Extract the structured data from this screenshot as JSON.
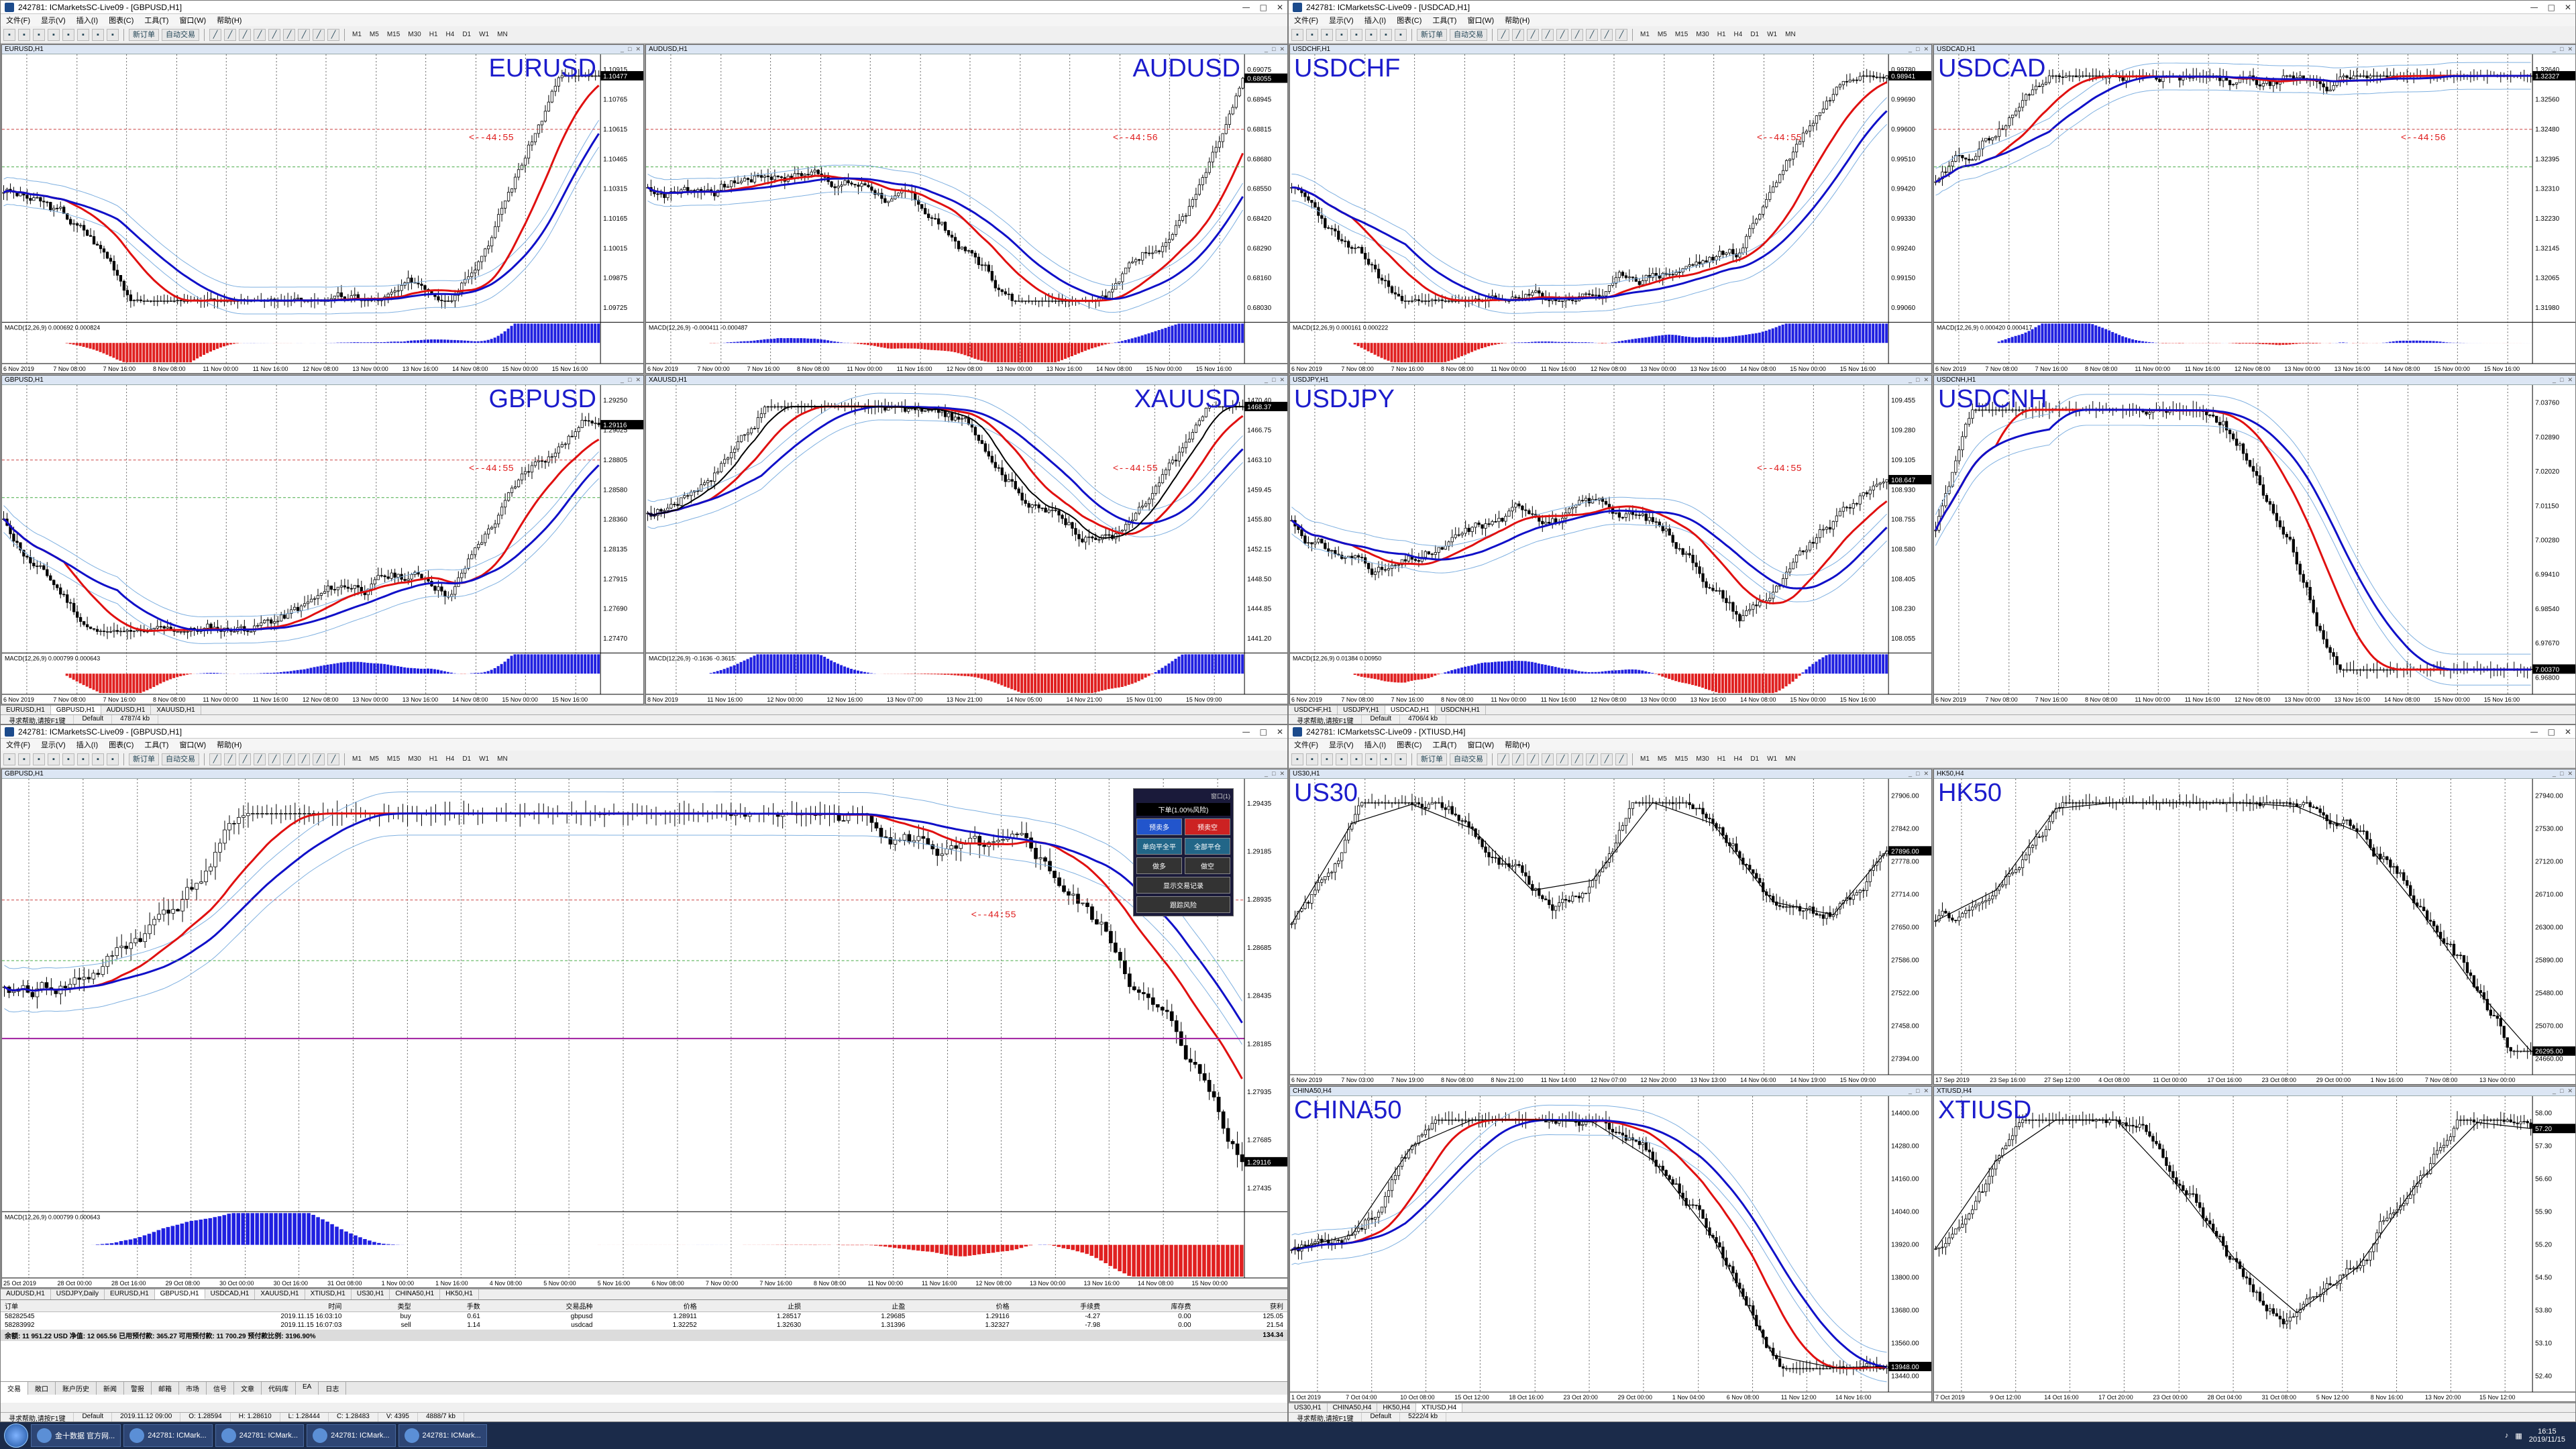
{
  "windows": [
    {
      "id": "tl",
      "title": "242781: ICMarketsSC-Live09 - [GBPUSD,H1]",
      "tabs": [
        "EURUSD,H1",
        "GBPUSD,H1",
        "AUDUSD,H1",
        "XAUUSD,H1"
      ],
      "active_tab": 1,
      "status": {
        "left": "寻求帮助,请按F1键",
        "mid": "Default",
        "right": "4787/4 kb"
      }
    },
    {
      "id": "tr",
      "title": "242781: ICMarketsSC-Live09 - [USDCAD,H1]",
      "tabs": [
        "USDCHF,H1",
        "USDJPY,H1",
        "USDCAD,H1",
        "USDCNH,H1"
      ],
      "active_tab": 2,
      "status": {
        "left": "寻求帮助,请按F1键",
        "mid": "Default",
        "right": "4706/4 kb"
      }
    },
    {
      "id": "bl",
      "title": "242781: ICMarketsSC-Live09 - [GBPUSD,H1]",
      "tabs": [
        "AUDUSD,H1",
        "USDJPY,Daily",
        "EURUSD,H1",
        "GBPUSD,H1",
        "USDCAD,H1",
        "XAUUSD,H1",
        "XTIUSD,H1",
        "US30,H1",
        "CHINA50,H1",
        "HK50,H1"
      ],
      "active_tab": 3,
      "status": {
        "left": "寻求帮助,请按F1键",
        "mid": "Default",
        "date": "2019.11.12 09:00",
        "o": "O: 1.28594",
        "h": "H: 1.28610",
        "l": "L: 1.28444",
        "c": "C: 1.28483",
        "v": "V: 4395",
        "right": "4888/7 kb"
      }
    },
    {
      "id": "br",
      "title": "242781: ICMarketsSC-Live09 - [XTIUSD,H4]",
      "tabs": [
        "US30,H1",
        "CHINA50,H4",
        "HK50,H4",
        "XTIUSD,H4"
      ],
      "active_tab": 3,
      "status": {
        "left": "寻求帮助,请按F1键",
        "mid": "Default",
        "right": "5222/4 kb"
      }
    }
  ],
  "menu": [
    "文件(F)",
    "显示(V)",
    "插入(I)",
    "图表(C)",
    "工具(T)",
    "窗口(W)",
    "帮助(H)"
  ],
  "toolbar": {
    "new_order": "新订单",
    "autotrade": "自动交易",
    "timeframes": [
      "M1",
      "M5",
      "M15",
      "M30",
      "H1",
      "H4",
      "D1",
      "W1",
      "MN"
    ]
  },
  "charts": [
    {
      "win": "tl",
      "head": "EURUSD,H1",
      "label": "EURUSD",
      "countdown": "<--44:55",
      "macd": "MACD(12,26,9) 0.000692 0.000824",
      "xaxis": [
        "6 Nov 2019",
        "7 Nov 08:00",
        "7 Nov 16:00",
        "8 Nov 08:00",
        "11 Nov 00:00",
        "11 Nov 16:00",
        "12 Nov 08:00",
        "13 Nov 00:00",
        "13 Nov 16:00",
        "14 Nov 08:00",
        "15 Nov 00:00",
        "15 Nov 16:00"
      ],
      "yaxis": [
        "1.10915",
        "1.10765",
        "1.10615",
        "1.10465",
        "1.10315",
        "1.10165",
        "1.10015",
        "1.09875",
        "1.09725"
      ],
      "price": "1.10477",
      "ml": true,
      "style": "fx",
      "seed": 3
    },
    {
      "win": "tl",
      "head": "AUDUSD,H1",
      "label": "AUDUSD",
      "countdown": "<--44:56",
      "macd": "MACD(12,26,9) -0.000411 -0.000487",
      "xaxis": [
        "6 Nov 2019",
        "7 Nov 00:00",
        "7 Nov 16:00",
        "8 Nov 08:00",
        "11 Nov 00:00",
        "11 Nov 16:00",
        "12 Nov 08:00",
        "13 Nov 00:00",
        "13 Nov 16:00",
        "14 Nov 08:00",
        "15 Nov 00:00",
        "15 Nov 16:00"
      ],
      "yaxis": [
        "0.69075",
        "0.68945",
        "0.68815",
        "0.68680",
        "0.68550",
        "0.68420",
        "0.68290",
        "0.68160",
        "0.68030"
      ],
      "price": "0.68055",
      "ml": true,
      "style": "fx",
      "seed": 7
    },
    {
      "win": "tl",
      "head": "GBPUSD,H1",
      "label": "GBPUSD",
      "countdown": "<--44:55",
      "macd": "MACD(12,26,9) 0.000799 0.000643",
      "xaxis": [
        "6 Nov 2019",
        "7 Nov 08:00",
        "7 Nov 16:00",
        "8 Nov 08:00",
        "11 Nov 00:00",
        "11 Nov 16:00",
        "12 Nov 08:00",
        "13 Nov 00:00",
        "13 Nov 16:00",
        "14 Nov 08:00",
        "15 Nov 00:00",
        "15 Nov 16:00"
      ],
      "yaxis": [
        "1.29250",
        "1.29025",
        "1.28805",
        "1.28580",
        "1.28360",
        "1.28135",
        "1.27915",
        "1.27690",
        "1.27470"
      ],
      "price": "1.29116",
      "ml": true,
      "style": "fx",
      "seed": 11
    },
    {
      "win": "tl",
      "head": "XAUUSD,H1",
      "label": "XAUUSD",
      "countdown": "<--44:55",
      "macd": "MACD(12,26,9) -0.1636 -0.3615",
      "xaxis": [
        "8 Nov 2019",
        "11 Nov 16:00",
        "12 Nov 00:00",
        "12 Nov 16:00",
        "13 Nov 07:00",
        "13 Nov 21:00",
        "14 Nov 05:00",
        "14 Nov 21:00",
        "15 Nov 01:00",
        "15 Nov 09:00"
      ],
      "yaxis": [
        "1470.40",
        "1466.75",
        "1463.10",
        "1459.45",
        "1455.80",
        "1452.15",
        "1448.50",
        "1444.85",
        "1441.20"
      ],
      "price": "1468.37",
      "ml": false,
      "style": "gold",
      "seed": 17
    },
    {
      "win": "tr",
      "head": "USDCHF,H1",
      "label": "USDCHF",
      "countdown": "<--44:55",
      "macd": "MACD(12,26,9) 0.000161 0.000222",
      "xaxis": [
        "6 Nov 2019",
        "7 Nov 08:00",
        "7 Nov 16:00",
        "8 Nov 08:00",
        "11 Nov 00:00",
        "11 Nov 16:00",
        "12 Nov 08:00",
        "13 Nov 00:00",
        "13 Nov 16:00",
        "14 Nov 08:00",
        "15 Nov 00:00",
        "15 Nov 16:00"
      ],
      "yaxis": [
        "0.99780",
        "0.99690",
        "0.99600",
        "0.99510",
        "0.99420",
        "0.99330",
        "0.99240",
        "0.99150",
        "0.99060"
      ],
      "price": "0.98941",
      "ml": false,
      "style": "fx",
      "seed": 23
    },
    {
      "win": "tr",
      "head": "USDCAD,H1",
      "label": "USDCAD",
      "countdown": "<--44:56",
      "macd": "MACD(12,26,9) 0.000420 0.000417",
      "xaxis": [
        "6 Nov 2019",
        "7 Nov 08:00",
        "7 Nov 16:00",
        "8 Nov 08:00",
        "11 Nov 00:00",
        "11 Nov 16:00",
        "12 Nov 08:00",
        "13 Nov 00:00",
        "13 Nov 16:00",
        "14 Nov 08:00",
        "15 Nov 00:00",
        "15 Nov 16:00"
      ],
      "yaxis": [
        "1.32640",
        "1.32560",
        "1.32480",
        "1.32395",
        "1.32310",
        "1.32230",
        "1.32145",
        "1.32065",
        "1.31980"
      ],
      "price": "1.32327",
      "ml": true,
      "style": "fxup",
      "seed": 29
    },
    {
      "win": "tr",
      "head": "USDJPY,H1",
      "label": "USDJPY",
      "countdown": "<--44:55",
      "macd": "MACD(12,26,9) 0.01384 0.00950",
      "xaxis": [
        "6 Nov 2019",
        "7 Nov 08:00",
        "7 Nov 16:00",
        "8 Nov 08:00",
        "11 Nov 00:00",
        "11 Nov 16:00",
        "12 Nov 08:00",
        "13 Nov 00:00",
        "13 Nov 16:00",
        "14 Nov 08:00",
        "15 Nov 00:00",
        "15 Nov 16:00"
      ],
      "yaxis": [
        "109.455",
        "109.280",
        "109.105",
        "108.930",
        "108.755",
        "108.580",
        "108.405",
        "108.230",
        "108.055"
      ],
      "price": "108.647",
      "ml": false,
      "style": "fx",
      "seed": 31
    },
    {
      "win": "tr",
      "head": "USDCNH,H1",
      "label": "USDCNH",
      "countdown": "",
      "macd": "",
      "xaxis": [
        "6 Nov 2019",
        "7 Nov 08:00",
        "7 Nov 16:00",
        "8 Nov 08:00",
        "11 Nov 00:00",
        "11 Nov 16:00",
        "12 Nov 08:00",
        "13 Nov 00:00",
        "13 Nov 16:00",
        "14 Nov 08:00",
        "15 Nov 00:00",
        "15 Nov 16:00"
      ],
      "yaxis": [
        "7.03760",
        "7.02890",
        "7.02020",
        "7.01150",
        "7.00280",
        "6.99410",
        "6.98540",
        "6.97670",
        "6.96800"
      ],
      "price": "7.00370",
      "ml": false,
      "style": "cnh",
      "seed": 37
    },
    {
      "win": "bl",
      "head": "GBPUSD,H1",
      "label": "",
      "countdown": "<--44:55",
      "macd": "MACD(12,26,9) 0.000799 0.000643",
      "xaxis": [
        "25 Oct 2019",
        "28 Oct 00:00",
        "28 Oct 16:00",
        "29 Oct 08:00",
        "30 Oct 00:00",
        "30 Oct 16:00",
        "31 Oct 08:00",
        "1 Nov 00:00",
        "1 Nov 16:00",
        "4 Nov 08:00",
        "5 Nov 00:00",
        "5 Nov 16:00",
        "6 Nov 08:00",
        "7 Nov 00:00",
        "7 Nov 16:00",
        "8 Nov 08:00",
        "11 Nov 00:00",
        "11 Nov 16:00",
        "12 Nov 08:00",
        "13 Nov 00:00",
        "13 Nov 16:00",
        "14 Nov 08:00",
        "15 Nov 00:00"
      ],
      "yaxis": [
        "1.29435",
        "1.29185",
        "1.28935",
        "1.28685",
        "1.28435",
        "1.28185",
        "1.27935",
        "1.27685",
        "1.27435"
      ],
      "price": "1.29116",
      "ml": true,
      "style": "big",
      "seed": 41
    },
    {
      "win": "br",
      "head": "US30,H1",
      "label": "US30",
      "countdown": "",
      "macd": "",
      "xaxis": [
        "6 Nov 2019",
        "7 Nov 03:00",
        "7 Nov 19:00",
        "8 Nov 08:00",
        "8 Nov 21:00",
        "11 Nov 14:00",
        "12 Nov 07:00",
        "12 Nov 20:00",
        "13 Nov 13:00",
        "14 Nov 06:00",
        "14 Nov 19:00",
        "15 Nov 09:00"
      ],
      "yaxis": [
        "27906.00",
        "27842.00",
        "27778.00",
        "27714.00",
        "27650.00",
        "27586.00",
        "27522.00",
        "27458.00",
        "27394.00"
      ],
      "price": "27896.00",
      "ml": false,
      "style": "zig",
      "seed": 43
    },
    {
      "win": "br",
      "head": "HK50,H4",
      "label": "HK50",
      "countdown": "",
      "macd": "",
      "xaxis": [
        "17 Sep 2019",
        "23 Sep 16:00",
        "27 Sep 12:00",
        "4 Oct 08:00",
        "11 Oct 00:00",
        "17 Oct 16:00",
        "23 Oct 08:00",
        "29 Oct 00:00",
        "1 Nov 16:00",
        "7 Nov 08:00",
        "13 Nov 00:00"
      ],
      "yaxis": [
        "27940.00",
        "27530.00",
        "27120.00",
        "26710.00",
        "26300.00",
        "25890.00",
        "25480.00",
        "25070.00",
        "24660.00"
      ],
      "price": "26295.00",
      "ml": false,
      "style": "hk",
      "seed": 47
    },
    {
      "win": "br",
      "head": "CHINA50,H4",
      "label": "CHINA50",
      "countdown": "",
      "macd": "",
      "xaxis": [
        "1 Oct 2019",
        "7 Oct 04:00",
        "10 Oct 08:00",
        "15 Oct 12:00",
        "18 Oct 16:00",
        "23 Oct 20:00",
        "29 Oct 00:00",
        "1 Nov 04:00",
        "6 Nov 08:00",
        "11 Nov 12:00",
        "14 Nov 16:00"
      ],
      "yaxis": [
        "14400.00",
        "14280.00",
        "14160.00",
        "14040.00",
        "13920.00",
        "13800.00",
        "13680.00",
        "13560.00",
        "13440.00"
      ],
      "price": "13948.00",
      "ml": false,
      "style": "zigup",
      "seed": 53
    },
    {
      "win": "br",
      "head": "XTIUSD,H4",
      "label": "XTIUSD",
      "countdown": "",
      "macd": "",
      "xaxis": [
        "7 Oct 2019",
        "9 Oct 12:00",
        "14 Oct 16:00",
        "17 Oct 20:00",
        "23 Oct 00:00",
        "28 Oct 04:00",
        "31 Oct 08:00",
        "5 Nov 12:00",
        "8 Nov 16:00",
        "13 Nov 20:00",
        "15 Nov 12:00"
      ],
      "yaxis": [
        "58.00",
        "57.30",
        "56.60",
        "55.90",
        "55.20",
        "54.50",
        "53.80",
        "53.10",
        "52.40"
      ],
      "price": "57.20",
      "ml": false,
      "style": "oil",
      "seed": 59
    }
  ],
  "order_panel": {
    "header": "下单(1.00%风险)",
    "top_label": "窗口(1)",
    "buttons": [
      [
        "预卖多",
        "预卖空"
      ],
      [
        "单向平全平",
        "全部平仓"
      ],
      [
        "做多",
        "做空"
      ],
      [
        "显示交易记录"
      ],
      [
        "跟踪风险"
      ]
    ]
  },
  "trade": {
    "headers": [
      "订单",
      "时间",
      "类型",
      "手数",
      "交易品种",
      "价格",
      "止损",
      "止盈",
      "价格",
      "手续费",
      "库存费",
      "获利"
    ],
    "rows": [
      [
        "58282545",
        "2019.11.15 16:03:10",
        "buy",
        "0.61",
        "gbpusd",
        "1.28911",
        "1.28517",
        "1.29685",
        "1.29116",
        "-4.27",
        "0.00",
        "125.05"
      ],
      [
        "58283992",
        "2019.11.15 16:07:03",
        "sell",
        "1.14",
        "usdcad",
        "1.32252",
        "1.32630",
        "1.31396",
        "1.32327",
        "-7.98",
        "0.00",
        "21.54"
      ]
    ],
    "summary": "余额: 11 951.22 USD  净值: 12 065.56  已用预付款: 365.27  可用预付款: 11 700.29  预付款比例: 3196.90%",
    "summary_profit": "134.34",
    "tabs": [
      "交易",
      "敞口",
      "账户历史",
      "新闻",
      "警报",
      "邮箱",
      "市场",
      "信号",
      "文章",
      "代码库",
      "EA",
      "日志"
    ],
    "active": 0
  },
  "taskbar": {
    "items": [
      "金十数据 官方网...",
      "242781: ICMark...",
      "242781: ICMark...",
      "242781: ICMark...",
      "242781: ICMark..."
    ],
    "time": "16:15",
    "date": "2019/11/15"
  },
  "colors": {
    "ma_red": "#e01010",
    "ma_blue": "#1010c8",
    "bull": "#000000",
    "bear": "#000000",
    "macd_up": "#2020e0",
    "macd_dn": "#e02020",
    "bg": "#ffffff",
    "label": "#1c1ccc"
  }
}
